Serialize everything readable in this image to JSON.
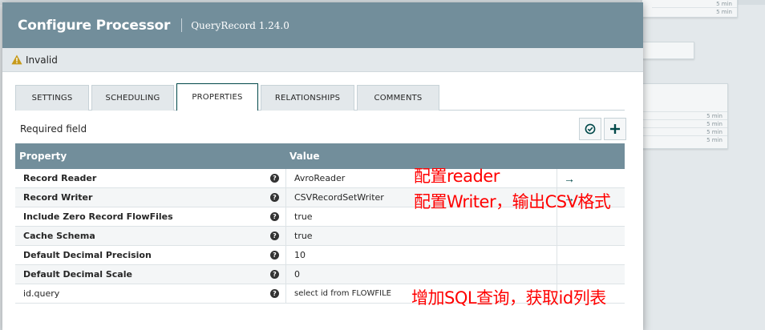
{
  "dialog": {
    "title": "Configure Processor",
    "subtitle": "QueryRecord 1.24.0"
  },
  "status": {
    "text": "Invalid",
    "icon": "warning-icon",
    "icon_color": "#c79a1a"
  },
  "tabs": [
    {
      "label": "SETTINGS",
      "active": false
    },
    {
      "label": "SCHEDULING",
      "active": false
    },
    {
      "label": "PROPERTIES",
      "active": true
    },
    {
      "label": "RELATIONSHIPS",
      "active": false
    },
    {
      "label": "COMMENTS",
      "active": false
    }
  ],
  "toolbar": {
    "required_label": "Required field",
    "verify_icon": "check-circle-icon",
    "add_icon": "plus-icon"
  },
  "table": {
    "col_property": "Property",
    "col_value": "Value",
    "rows": [
      {
        "name": "Record Reader",
        "value": "AvroReader",
        "required": true,
        "action": "→"
      },
      {
        "name": "Record Writer",
        "value": "CSVRecordSetWriter",
        "required": true,
        "action": "→"
      },
      {
        "name": "Include Zero Record FlowFiles",
        "value": "true",
        "required": true,
        "action": ""
      },
      {
        "name": "Cache Schema",
        "value": "true",
        "required": true,
        "action": ""
      },
      {
        "name": "Default Decimal Precision",
        "value": "10",
        "required": true,
        "action": ""
      },
      {
        "name": "Default Decimal Scale",
        "value": "0",
        "required": true,
        "action": ""
      },
      {
        "name": "id.query",
        "value": "select id from FLOWFILE",
        "required": false,
        "action": ""
      }
    ]
  },
  "annotations": {
    "reader": "配置reader",
    "writer": "配置Writer，输出CSV格式",
    "query": "增加SQL查询，获取id列表"
  },
  "background": {
    "row_text": "5 min"
  },
  "colors": {
    "header_bg": "#728e9b",
    "accent": "#004849",
    "annotation": "#ff0000"
  }
}
